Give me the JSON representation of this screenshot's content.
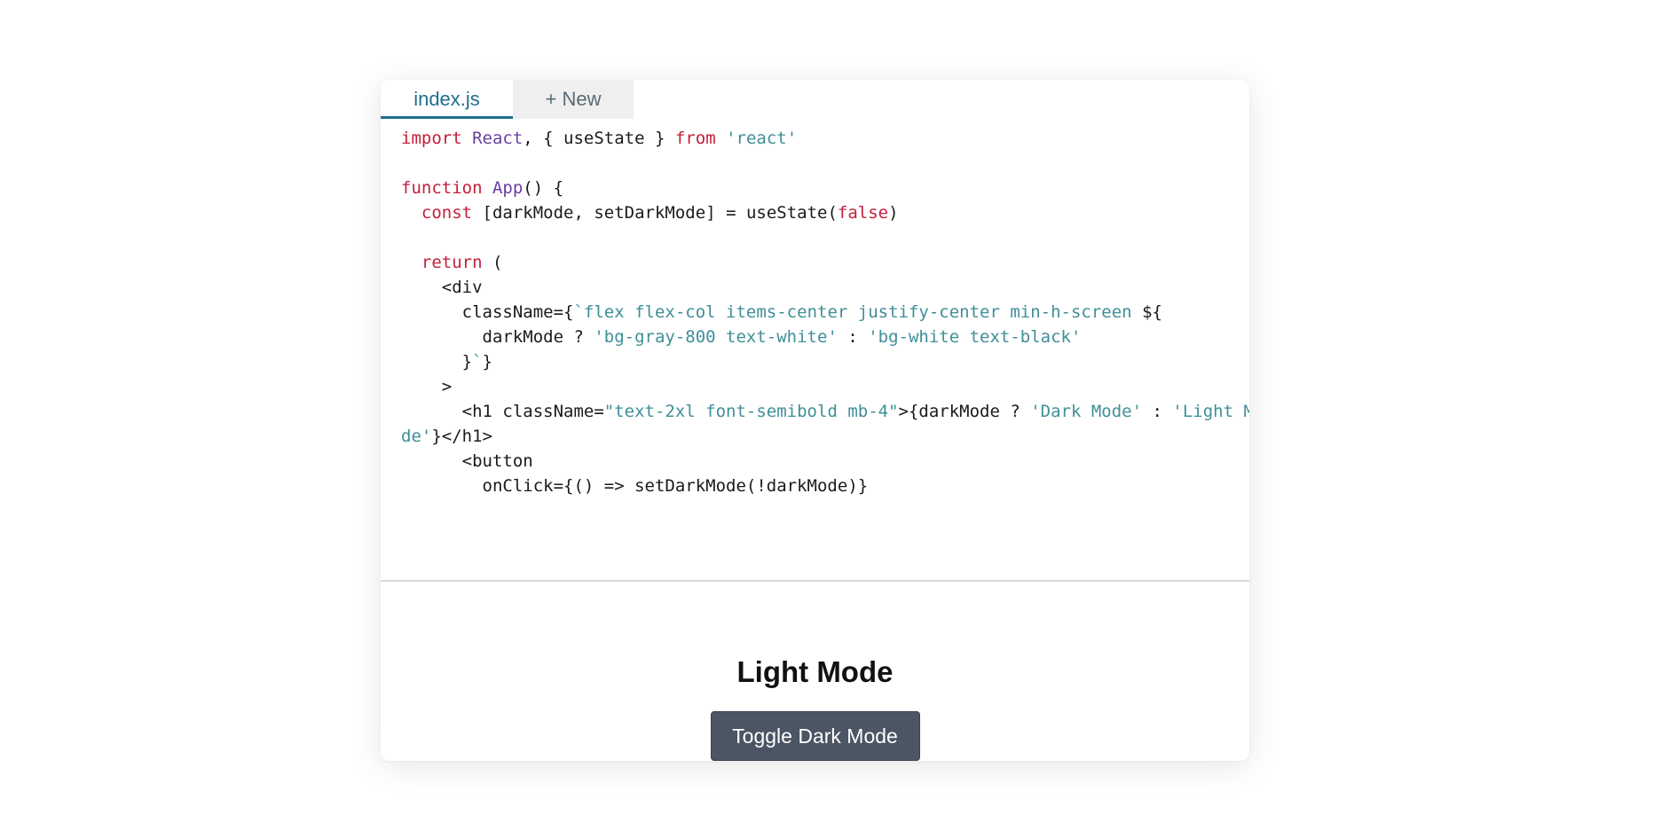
{
  "tabs": {
    "active_label": "index.js",
    "new_label": "+ New"
  },
  "code_lines": [
    [
      {
        "t": "import",
        "c": "kw"
      },
      {
        "t": " "
      },
      {
        "t": "React",
        "c": "nm"
      },
      {
        "t": ", { useState } "
      },
      {
        "t": "from",
        "c": "kw"
      },
      {
        "t": " "
      },
      {
        "t": "'react'",
        "c": "st"
      }
    ],
    [],
    [
      {
        "t": "function",
        "c": "kw"
      },
      {
        "t": " "
      },
      {
        "t": "App",
        "c": "nm"
      },
      {
        "t": "() {"
      }
    ],
    [
      {
        "t": "  "
      },
      {
        "t": "const",
        "c": "kw"
      },
      {
        "t": " [darkMode, setDarkMode] = useState("
      },
      {
        "t": "false",
        "c": "kw"
      },
      {
        "t": ")"
      }
    ],
    [],
    [
      {
        "t": "  "
      },
      {
        "t": "return",
        "c": "kw"
      },
      {
        "t": " ("
      }
    ],
    [
      {
        "t": "    <div"
      }
    ],
    [
      {
        "t": "      className={"
      },
      {
        "t": "`flex flex-col items-center justify-center min-h-screen ",
        "c": "st"
      },
      {
        "t": "${"
      }
    ],
    [
      {
        "t": "        darkMode ? "
      },
      {
        "t": "'bg-gray-800 text-white'",
        "c": "st"
      },
      {
        "t": " : "
      },
      {
        "t": "'bg-white text-black'",
        "c": "st"
      }
    ],
    [
      {
        "t": "      }"
      },
      {
        "t": "`",
        "c": "st"
      },
      {
        "t": "}"
      }
    ],
    [
      {
        "t": "    >"
      }
    ],
    [
      {
        "t": "      <h1 className="
      },
      {
        "t": "\"text-2xl font-semibold mb-4\"",
        "c": "st"
      },
      {
        "t": ">{darkMode ? "
      },
      {
        "t": "'Dark Mode'",
        "c": "st"
      },
      {
        "t": " : "
      },
      {
        "t": "'Light Mo",
        "c": "st"
      }
    ],
    [
      {
        "t": "de'",
        "c": "st"
      },
      {
        "t": "}</h1>"
      }
    ],
    [
      {
        "t": "      <button"
      }
    ],
    [
      {
        "t": "        onClick={() => setDarkMode(!darkMode)}"
      }
    ]
  ],
  "preview": {
    "heading": "Light Mode",
    "button_label": "Toggle Dark Mode"
  },
  "colors": {
    "accent": "#1f6f8f",
    "keyword": "#c51e3a",
    "identifier": "#6a3fa0",
    "string": "#3f8f98",
    "button_bg": "#4b5563"
  }
}
